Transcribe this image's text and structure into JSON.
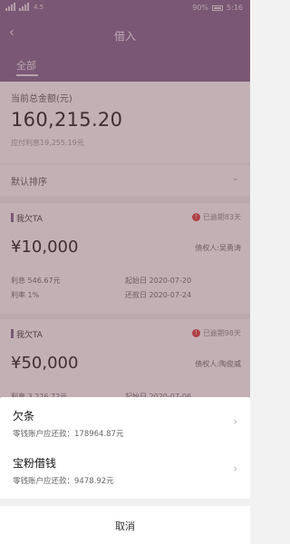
{
  "status_bar": {
    "network": "4.5",
    "battery": "90%",
    "time": "5:16"
  },
  "header": {
    "title": "借入",
    "tab_all": "全部"
  },
  "summary": {
    "label": "当前总金额(元)",
    "value": "160,215.20",
    "sub": "应付利息19,255.19元"
  },
  "sort": {
    "label": "默认排序"
  },
  "cards": [
    {
      "head": "我欠TA",
      "overdue": "已逾期83天",
      "amount": "¥10,000",
      "creditor": "债权人:吴勇涛",
      "interest": "利息 546.67元",
      "rate": "利率 1%",
      "start": "起始日 2020-07-20",
      "repay": "还款日 2020-07-24"
    },
    {
      "head": "我欠TA",
      "overdue": "已逾期98天",
      "amount": "¥50,000",
      "creditor": "债权人:陶俊威",
      "interest": "利息 3,226.72元",
      "start": "起始日 2020-07-06"
    }
  ],
  "sheet": {
    "options": [
      {
        "title": "欠条",
        "sub": "零钱账户应还款：178964.87元"
      },
      {
        "title": "宝粉借钱",
        "sub": "零钱账户应还款：9478.92元"
      }
    ],
    "cancel": "取消"
  }
}
